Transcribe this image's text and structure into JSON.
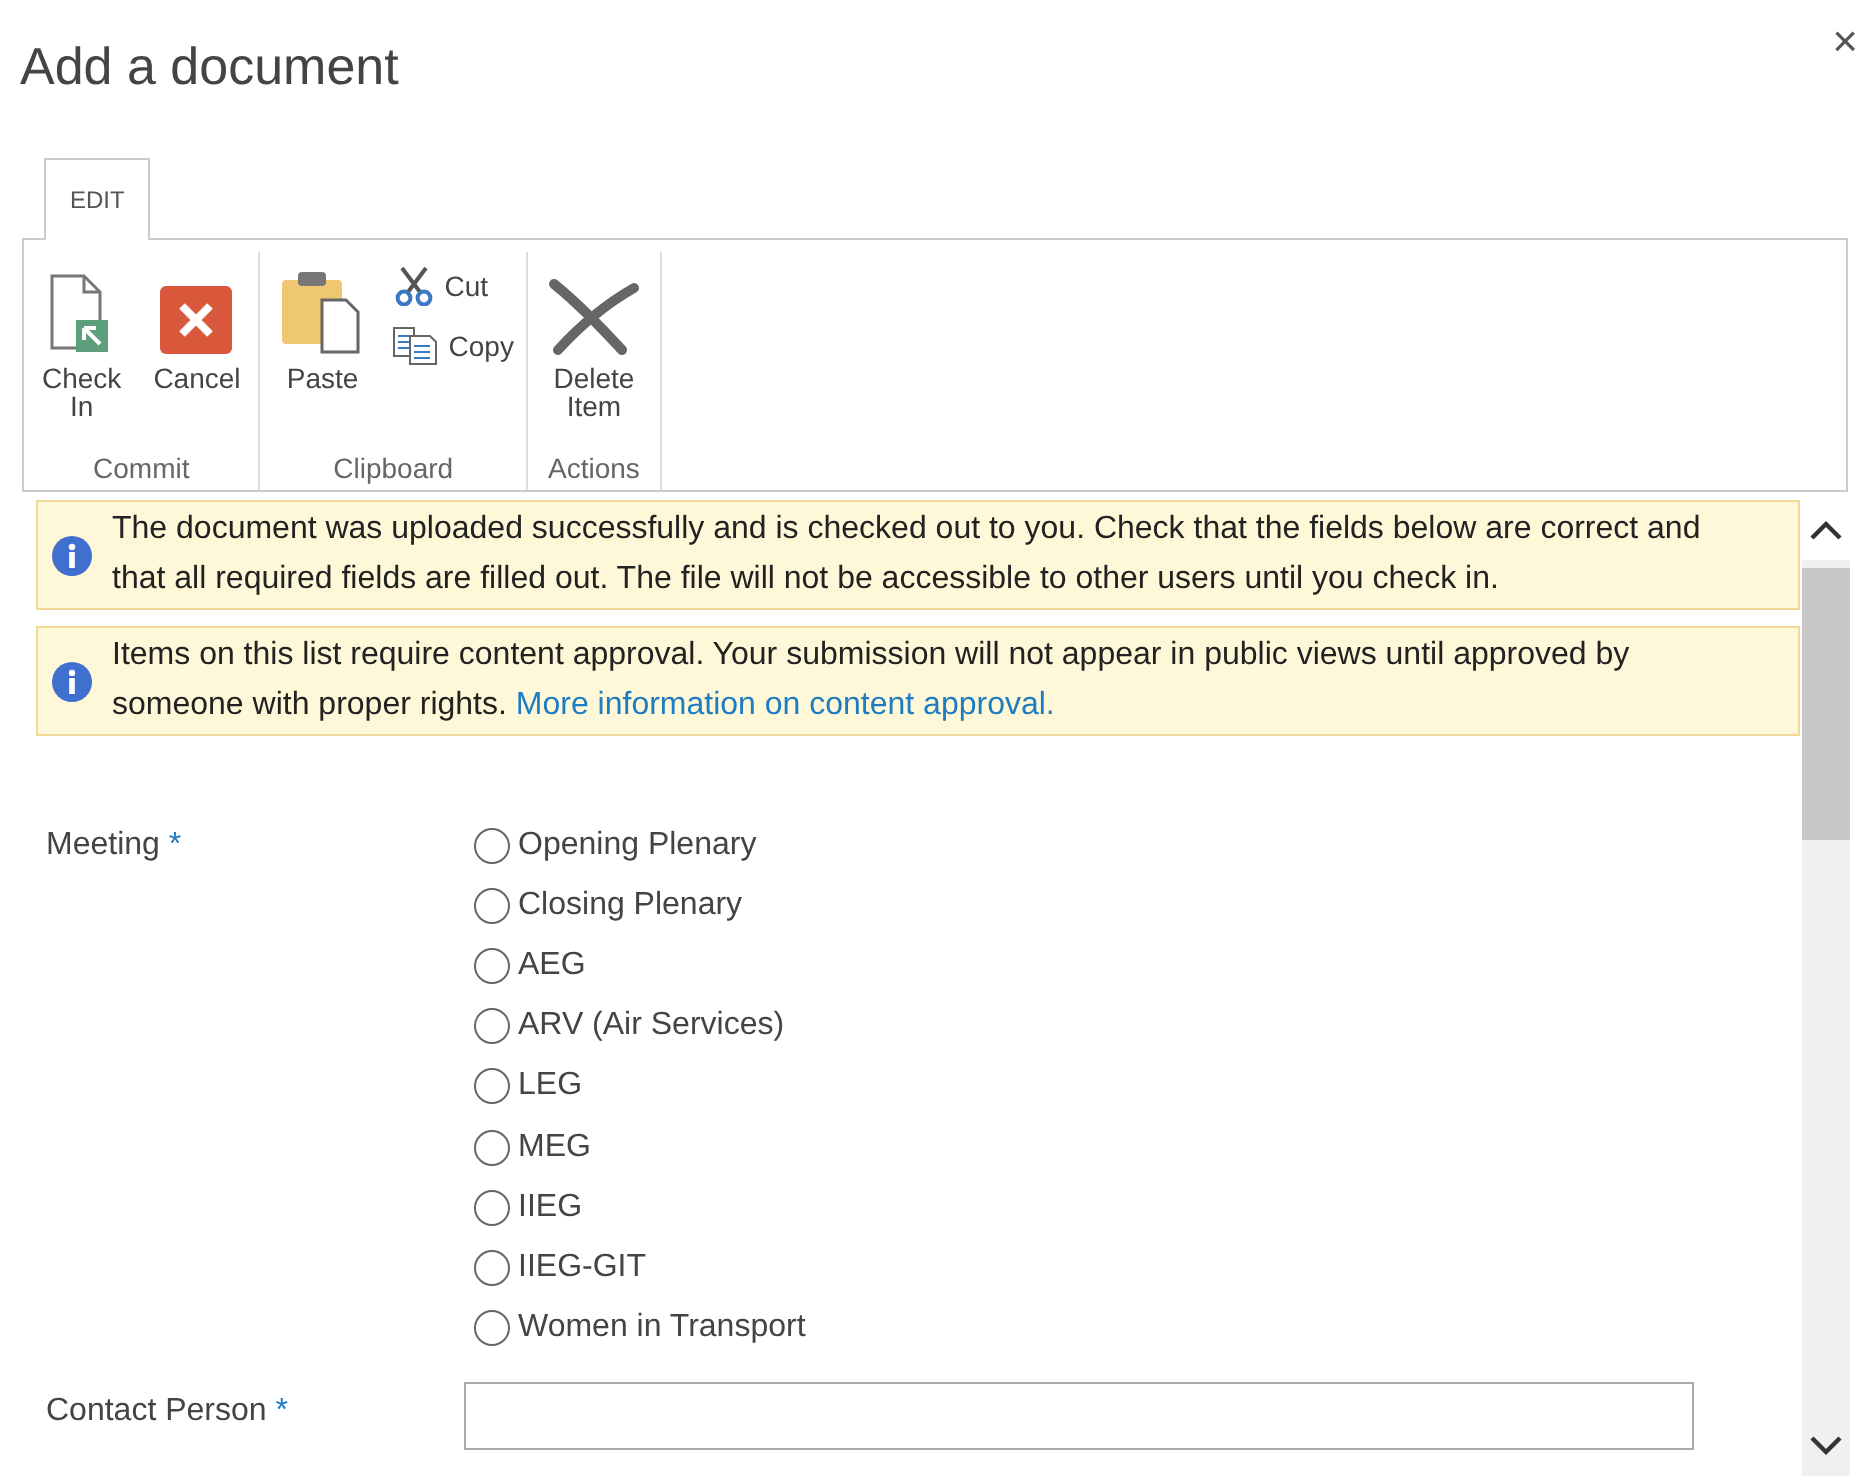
{
  "dialog": {
    "title": "Add a document",
    "close": "×"
  },
  "ribbon": {
    "tabs": [
      {
        "label": "EDIT",
        "selected": true
      }
    ],
    "groups": [
      {
        "label": "Commit",
        "buttons": [
          {
            "label": "Check In",
            "kind": "large"
          },
          {
            "label": "Cancel",
            "kind": "large"
          }
        ]
      },
      {
        "label": "Clipboard",
        "buttons": [
          {
            "label": "Paste",
            "kind": "large"
          },
          {
            "label": "Cut",
            "kind": "small"
          },
          {
            "label": "Copy",
            "kind": "small"
          }
        ]
      },
      {
        "label": "Actions",
        "buttons": [
          {
            "label": "Delete Item",
            "kind": "large"
          }
        ]
      }
    ]
  },
  "messages": [
    {
      "text": "The document was uploaded successfully and is checked out to you. Check that the fields below are correct and that all required fields are filled out. The file will not be accessible to other users until you check in."
    },
    {
      "text": "Items on this list require content approval. Your submission will not appear in public views until approved by someone with proper rights.",
      "link": "More information on content approval."
    }
  ],
  "form": {
    "fields": [
      {
        "label": "Meeting",
        "required_mark": "*",
        "kind": "radio",
        "options": [
          {
            "label": "Opening Plenary",
            "selected": false
          },
          {
            "label": "Closing Plenary",
            "selected": false
          },
          {
            "label": "AEG",
            "selected": false
          },
          {
            "label": "ARV (Air Services)",
            "selected": false
          },
          {
            "label": "LEG",
            "selected": false
          },
          {
            "label": "MEG",
            "selected": false
          },
          {
            "label": "IIEG",
            "selected": false
          },
          {
            "label": "IIEG-GIT",
            "selected": false
          },
          {
            "label": "Women in Transport",
            "selected": false
          }
        ]
      },
      {
        "label": "Contact Person",
        "required_mark": "*",
        "kind": "text"
      }
    ]
  }
}
